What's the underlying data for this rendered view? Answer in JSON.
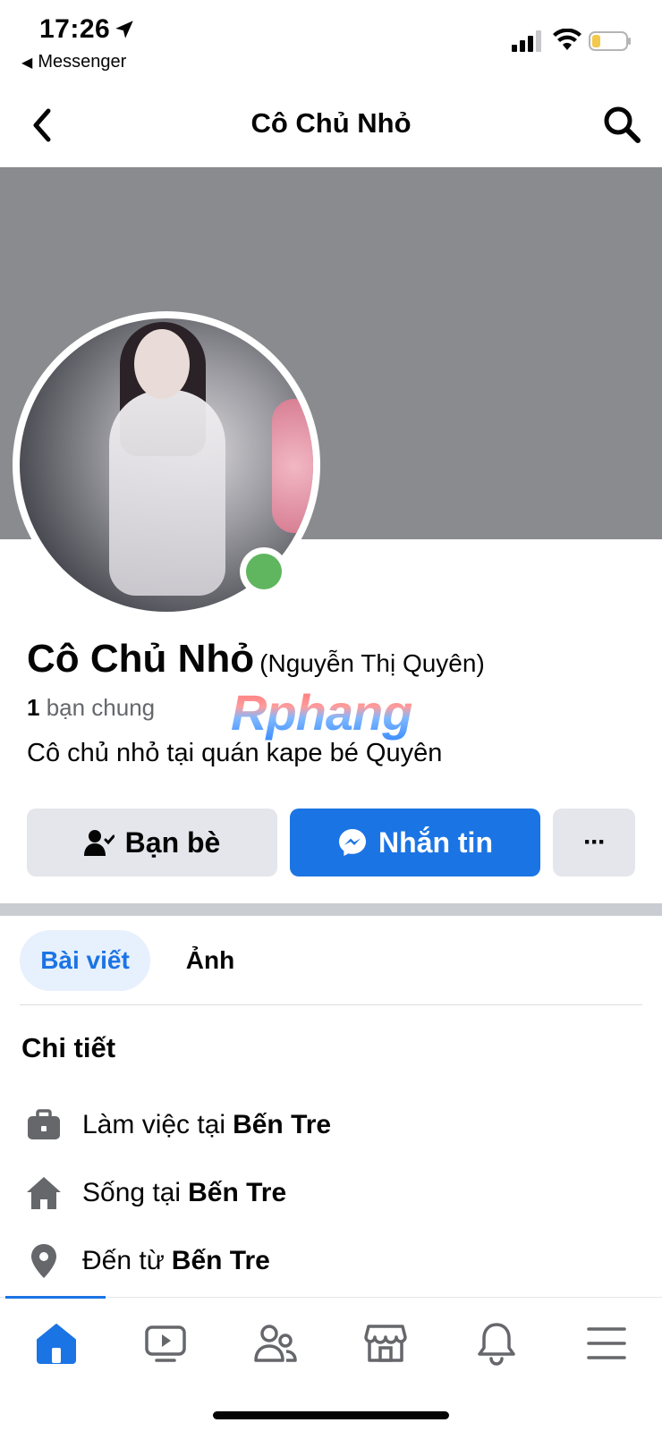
{
  "status_bar": {
    "time": "17:26",
    "back_app": "Messenger"
  },
  "nav": {
    "title": "Cô Chủ Nhỏ"
  },
  "profile": {
    "name": "Cô Chủ Nhỏ",
    "alternate_name": "(Nguyễn Thị Quyên)",
    "mutual_count": "1",
    "mutual_label": "bạn chung",
    "watermark": "Rphang",
    "bio": "Cô chủ nhỏ tại quán kape bé Quyên",
    "online": true
  },
  "actions": {
    "friends_label": "Bạn bè",
    "message_label": "Nhắn tin",
    "more_label": "···"
  },
  "tabs": [
    {
      "label": "Bài viết",
      "active": true
    },
    {
      "label": "Ảnh",
      "active": false
    }
  ],
  "details": {
    "title": "Chi tiết",
    "items": [
      {
        "prefix": "Làm việc tại",
        "value": "Bến Tre",
        "icon": "briefcase-icon"
      },
      {
        "prefix": "Sống tại",
        "value": "Bến Tre",
        "icon": "home-icon"
      },
      {
        "prefix": "Đến từ",
        "value": "Bến Tre",
        "icon": "location-pin-icon"
      }
    ]
  },
  "bottom_nav": [
    "home",
    "video",
    "friends",
    "marketplace",
    "notifications",
    "menu"
  ],
  "colors": {
    "accent": "#1b74e4",
    "cover": "#8a8b8f",
    "online": "#5fb65f"
  }
}
